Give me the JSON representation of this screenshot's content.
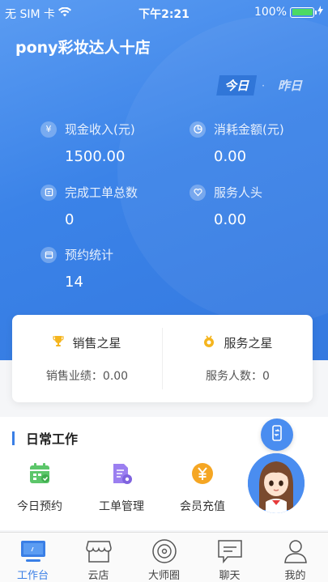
{
  "status_bar": {
    "carrier": "无 SIM 卡",
    "time": "下午2:21",
    "battery": "100%",
    "battery_level": 1.0
  },
  "store": {
    "name": "pony彩妆达人十店"
  },
  "day_toggle": {
    "today": "今日",
    "separator": "·",
    "yesterday": "昨日",
    "selected": "today"
  },
  "stats": {
    "cash_income": {
      "label": "现金收入(元)",
      "value": "1500.00",
      "icon": "yen-icon"
    },
    "consumption": {
      "label": "消耗金额(元)",
      "value": "0.00",
      "icon": "pie-chart-icon"
    },
    "completed_orders": {
      "label": "完成工单总数",
      "value": "0",
      "icon": "order-icon"
    },
    "service_heads": {
      "label": "服务人头",
      "value": "0.00",
      "icon": "heart-icon"
    },
    "appointments": {
      "label": "预约统计",
      "value": "14",
      "icon": "calendar-icon"
    }
  },
  "stars": {
    "sales_star": {
      "title": "销售之星",
      "sub": "销售业绩：0.00",
      "icon": "trophy-icon"
    },
    "service_star": {
      "title": "服务之星",
      "sub": "服务人数：0",
      "icon": "medal-icon"
    }
  },
  "daily": {
    "title": "日常工作",
    "tools": [
      {
        "label": "今日预约",
        "icon": "calendar-check-icon",
        "color": "#5cc66a"
      },
      {
        "label": "工单管理",
        "icon": "document-gear-icon",
        "color": "#9b7ff0"
      },
      {
        "label": "会员充值",
        "icon": "yen-coin-icon",
        "color": "#f5a623"
      }
    ]
  },
  "tabs": [
    {
      "label": "工作台",
      "icon": "monitor-icon",
      "active": true
    },
    {
      "label": "云店",
      "icon": "store-icon",
      "active": false
    },
    {
      "label": "大师圈",
      "icon": "disc-icon",
      "active": false
    },
    {
      "label": "聊天",
      "icon": "chat-icon",
      "active": false
    },
    {
      "label": "我的",
      "icon": "person-icon",
      "active": false
    }
  ],
  "colors": {
    "primary": "#3a7fe6",
    "hero_start": "#5b9cf2",
    "hero_end": "#3479e0"
  }
}
